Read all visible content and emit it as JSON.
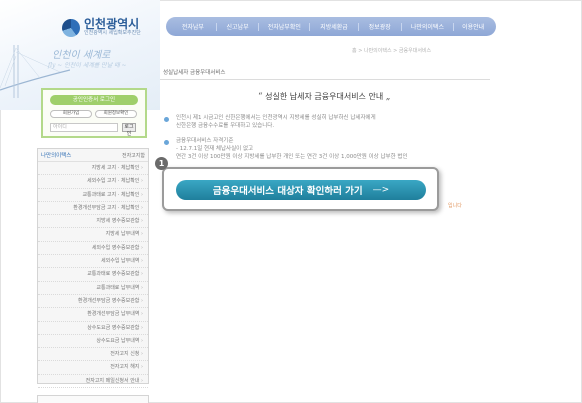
{
  "brand": {
    "name": "인천광역시",
    "subtitle": "인천광역시 세입확보추진단",
    "slogan_line1": "인천이 세계로",
    "slogan_line2": "fly ~ 인천이 세계를 만날 때 ~"
  },
  "gnb": {
    "items": [
      "전자납부",
      "신고납부",
      "전자납부확인",
      "지방세환급",
      "정보광장",
      "나만의이택스",
      "이용안내"
    ]
  },
  "breadcrumb": "홈 > 나만의이택스 > 금융우대서비스",
  "page": {
    "subtitle": "성실납세자 금융우대서비스",
    "heading": "성실한 납세자 금융우대서비스 안내",
    "quote_open": "“",
    "quote_close": "„",
    "para1_line1": "인천시 제1 시금고인 신한은행에서는 인천광역시 지방세를 성실히 납부하신 납세자에게",
    "para1_line2": "신한은행 금융수수료를 우대하고 있습니다.",
    "para2_title": "금융우대서비스 자격기준",
    "para2_line1": "- 12.7.1일 현재 체납사실이 없고",
    "para2_line2": "연간 3건 이상 100만원 이상 지방세를 납부한 개인 또는 연간 3건 이상 1,000만원 이상 납부한 법인",
    "orange_note": "입니다"
  },
  "callout": {
    "step_number": "1",
    "cta_label": "금융우대서비스 대상자 확인하러 가기",
    "cta_arrow": "—>"
  },
  "cert_box": {
    "title": "공인인증서 로그인",
    "btn_left": "회원가입",
    "btn_right": "회원정보확인",
    "input_placeholder": "아이디",
    "go_label": "로그인"
  },
  "menu": {
    "head_left": "나만의이택스",
    "head_right": "전자고지함",
    "items": [
      "지방세 고지 · 체납확인",
      "세외수입 고지 · 체납확인",
      "교통과태료 고지 · 체납확인",
      "환경개선부담금 고지 · 체납확인",
      "지방세 영수증보관함",
      "지방세 납부내역",
      "세외수입 영수증보관함",
      "세외수입 납부내역",
      "교통과태료 영수증보관함",
      "교통과태료 납부내역",
      "환경개선부담금 영수증보관함",
      "환경개선부담금 납부내역",
      "상수도요금 영수증보관함",
      "상수도요금 납부내역",
      "전자고지 신청",
      "전자고지 해지",
      "전자고지 메일신청서 안내"
    ]
  }
}
